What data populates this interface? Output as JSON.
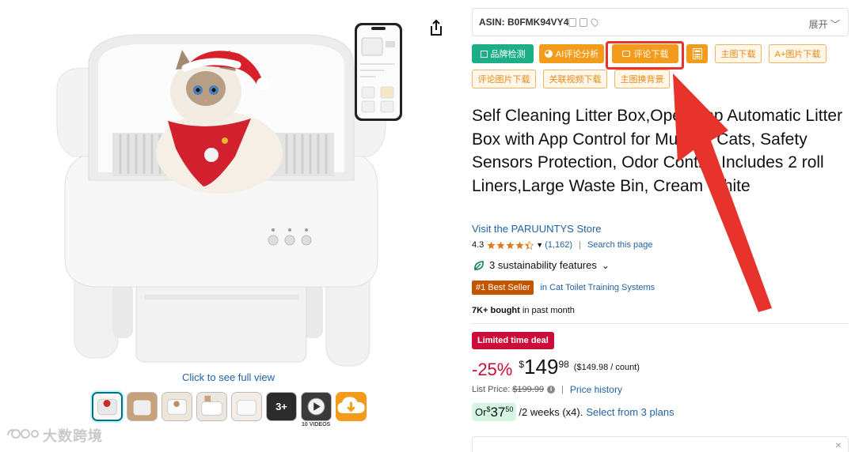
{
  "gallery": {
    "full_view_label": "Click to see full view",
    "videos_label": "10 VIDEOS",
    "more_count": "3+",
    "watermark": "大数跨境"
  },
  "plugin": {
    "asin_label": "ASIN: B0FMK94VY4",
    "expand_label": "展开",
    "buttons": {
      "brand_check": "品牌检测",
      "ai_review": "AI评论分析",
      "review_download": "评论下载",
      "main_image_download": "主图下载",
      "a_plus_download": "A+图片下载",
      "review_image_download": "评论图片下载",
      "related_video_download": "关联视频下载",
      "main_image_bg": "主图换背景"
    }
  },
  "product": {
    "title": "Self Cleaning Litter Box,Open-Top Automatic Litter Box with App Control for Multiple Cats, Safety Sensors Protection, Odor Control Includes 2 roll Liners,Large Waste Bin, Cream White",
    "store_link": "Visit the PARUUNTYS Store",
    "rating": "4.3",
    "rating_count": "(1,162)",
    "search_page": "Search this page",
    "sustainability": "3 sustainability features",
    "best_seller_badge": "#1 Best Seller",
    "category": "in Cat Toilet Training Systems",
    "bought_bold": "7K+ bought",
    "bought_rest": " in past month",
    "deal_badge": "Limited time deal",
    "discount": "-25%",
    "currency": "$",
    "price_whole": "149",
    "price_fraction": "98",
    "unit_price": "($149.98 / count)",
    "list_price_label": "List Price:",
    "list_price": "$199.99",
    "price_history": "Price history",
    "inst_or": "Or ",
    "inst_currency": "$",
    "inst_whole": "37",
    "inst_fraction": "50",
    "inst_period": "/2 weeks (x4).",
    "inst_plans": "Select from 3 plans"
  },
  "colors": {
    "link": "#2162a1",
    "deal": "#cc0c39",
    "plugin_orange": "#f39c1b",
    "plugin_green": "#1cae86",
    "annotation_red": "#e8322c",
    "best_seller": "#c45500"
  }
}
